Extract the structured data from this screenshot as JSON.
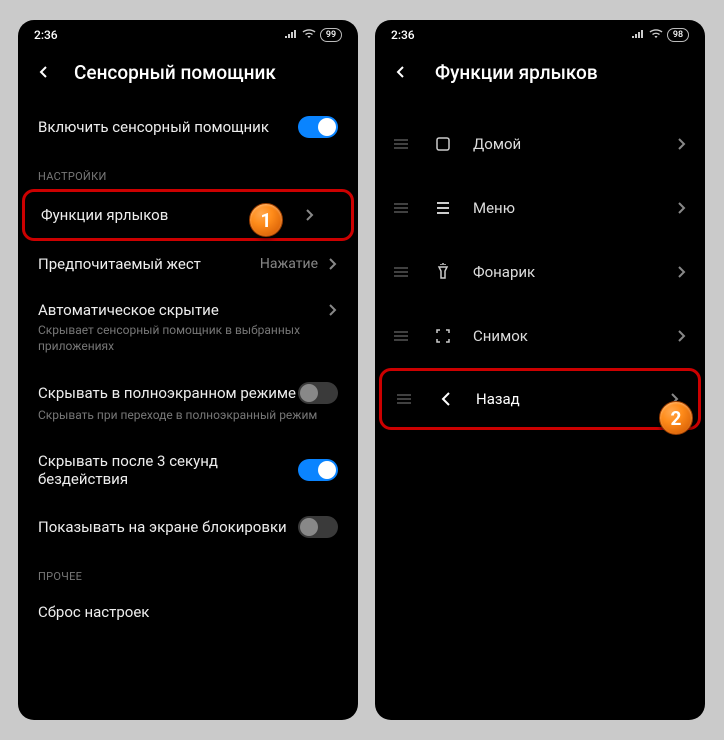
{
  "left": {
    "status": {
      "time": "2:36",
      "battery": "99"
    },
    "title": "Сенсорный помощник",
    "enable": {
      "label": "Включить сенсорный помощник",
      "on": true
    },
    "section_settings": "НАСТРОЙКИ",
    "shortcuts": {
      "label": "Функции ярлыков"
    },
    "gesture": {
      "label": "Предпочитаемый жест",
      "value": "Нажатие"
    },
    "autohide": {
      "label": "Автоматическое скрытие",
      "sub": "Скрывает сенсорный помощник в выбранных приложениях"
    },
    "fullscreen": {
      "label": "Скрывать в полноэкранном режиме",
      "sub": "Скрывать при переходе в полноэкранный режим",
      "on": false
    },
    "hide3s": {
      "label": "Скрывать после 3 секунд бездействия",
      "on": true
    },
    "lockscreen": {
      "label": "Показывать на экране блокировки",
      "on": false
    },
    "section_other": "ПРОЧЕЕ",
    "reset": {
      "label": "Сброс настроек"
    }
  },
  "right": {
    "status": {
      "time": "2:36",
      "battery": "98"
    },
    "title": "Функции ярлыков",
    "items": [
      {
        "icon": "home",
        "label": "Домой"
      },
      {
        "icon": "menu",
        "label": "Меню"
      },
      {
        "icon": "flashlight",
        "label": "Фонарик"
      },
      {
        "icon": "screenshot",
        "label": "Снимок"
      },
      {
        "icon": "back",
        "label": "Назад"
      }
    ]
  },
  "badges": {
    "b1": "1",
    "b2": "2"
  }
}
